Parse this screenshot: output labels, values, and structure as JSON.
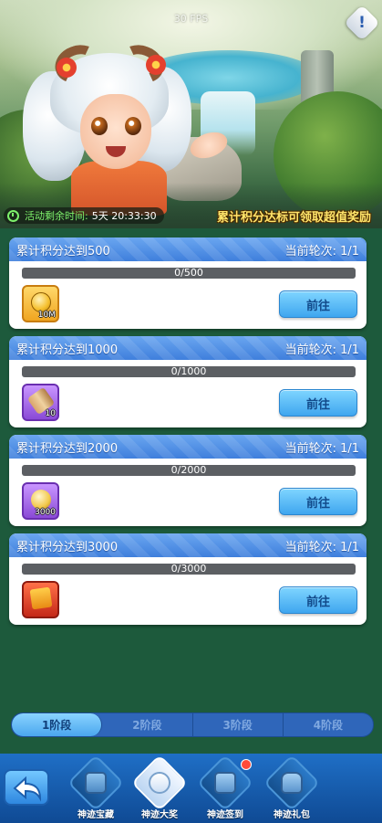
{
  "hud": {
    "fps": "30 FPS",
    "info_icon": "exclamation-icon"
  },
  "event": {
    "timer_label": "活动剩余时间:",
    "timer_value": "5天 20:33:30",
    "slogan": "累计积分达标可领取超值奖励"
  },
  "tasks": [
    {
      "title": "累计积分达到500",
      "round_label": "当前轮次: 1/1",
      "progress_text": "0/500",
      "progress": 0,
      "reward_icon": "gold-coin-icon",
      "reward_qty": "10M",
      "button": "前往"
    },
    {
      "title": "累计积分达到1000",
      "round_label": "当前轮次: 1/1",
      "progress_text": "0/1000",
      "progress": 0,
      "reward_icon": "scroll-icon",
      "reward_qty": "10",
      "button": "前往"
    },
    {
      "title": "累计积分达到2000",
      "round_label": "当前轮次: 1/1",
      "progress_text": "0/2000",
      "progress": 0,
      "reward_icon": "coin-icon",
      "reward_qty": "3000",
      "button": "前往"
    },
    {
      "title": "累计积分达到3000",
      "round_label": "当前轮次: 1/1",
      "progress_text": "0/3000",
      "progress": 0,
      "reward_icon": "mystery-card-icon",
      "reward_qty": "",
      "button": "前往"
    }
  ],
  "stages": [
    {
      "label": "1阶段",
      "active": true
    },
    {
      "label": "2阶段",
      "active": false
    },
    {
      "label": "3阶段",
      "active": false
    },
    {
      "label": "4阶段",
      "active": false
    }
  ],
  "nav": {
    "back_icon": "back-arrow-icon",
    "items": [
      {
        "label": "神迹宝藏",
        "icon": "treasure-chest-icon",
        "active": false,
        "badge": false
      },
      {
        "label": "神迹大奖",
        "icon": "bow-icon",
        "active": true,
        "badge": false
      },
      {
        "label": "神迹签到",
        "icon": "gift-box-icon",
        "active": false,
        "badge": true
      },
      {
        "label": "神迹礼包",
        "icon": "gift-bag-icon",
        "active": false,
        "badge": false
      }
    ]
  },
  "colors": {
    "header_blue": "#3f7fdc",
    "button_blue": "#3fa6ef",
    "timer_green": "#7df06b",
    "slogan_yellow": "#ffe56a",
    "background": "#1d5a3c"
  }
}
